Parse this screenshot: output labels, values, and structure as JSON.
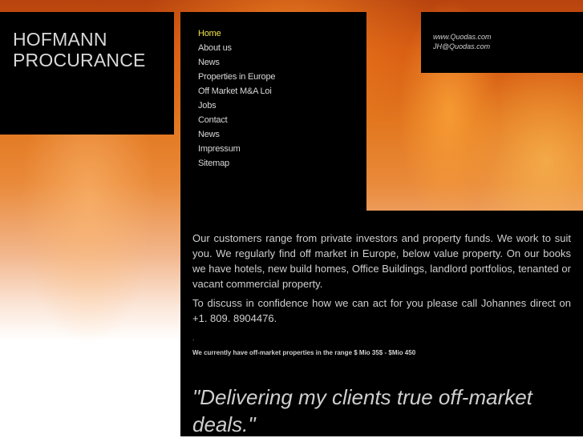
{
  "brand": {
    "line1": "HOFMANN",
    "line2": "PROCURANCE"
  },
  "nav": [
    {
      "label": "Home",
      "active": true
    },
    {
      "label": "About us"
    },
    {
      "label": "News"
    },
    {
      "label": "Properties in Europe"
    },
    {
      "label": "Off Market M&A Loi"
    },
    {
      "label": "Jobs"
    },
    {
      "label": "Contact"
    },
    {
      "label": "News"
    },
    {
      "label": "Impressum"
    },
    {
      "label": "Sitemap"
    }
  ],
  "contact": {
    "website": "www.Quodas.com",
    "email": "JH@Quodas.com"
  },
  "content": {
    "paragraph1": "Our customers range from private investors and property funds. We work to suit you. We regularly find off market in Europe, below value property. On our books we have hotels, new build homes, Office Buildings, landlord portfolios, tenanted or vacant commercial property.",
    "paragraph2": "To discuss in confidence how we can act for you please call Johannes direct on +1. 809. 8904476.",
    "dot": ".",
    "range_note": "We currently have off-market properties in the range  $ Mio 35$ - $Mio 450",
    "quote": "\"Delivering my clients true off-market deals.\""
  },
  "colors": {
    "active_nav": "#f2e24a",
    "text": "#d8d8d8",
    "panel": "#000000"
  }
}
